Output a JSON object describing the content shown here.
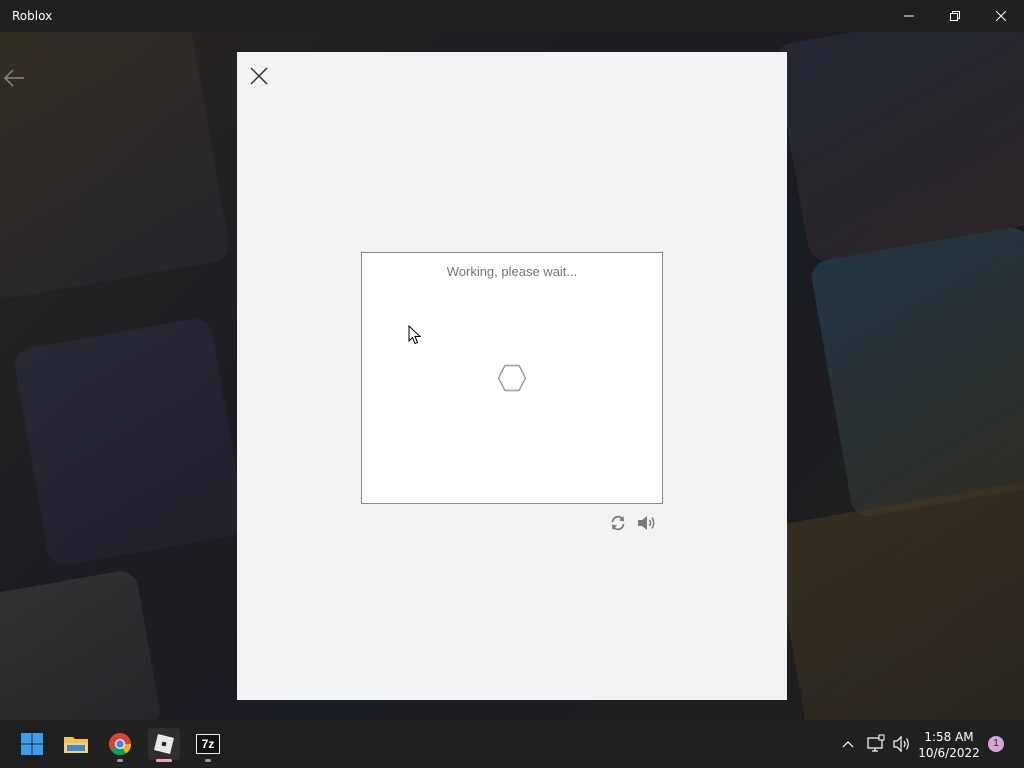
{
  "window": {
    "title": "Roblox"
  },
  "captcha": {
    "status_text": "Working, please wait...",
    "spinner_icon": "hexagon-spinner-icon",
    "refresh_icon": "refresh-icon",
    "audio_icon": "speaker-icon"
  },
  "taskbar": {
    "apps": [
      "start-menu",
      "file-explorer",
      "chrome",
      "roblox",
      "7-zip"
    ],
    "sevenzip_label": "7z",
    "time": "1:58 AM",
    "date": "10/6/2022",
    "notification_count": "1"
  },
  "colors": {
    "modal_bg": "#f2f3f5",
    "titlebar_bg": "#202020",
    "taskbar_bg": "#202020"
  }
}
